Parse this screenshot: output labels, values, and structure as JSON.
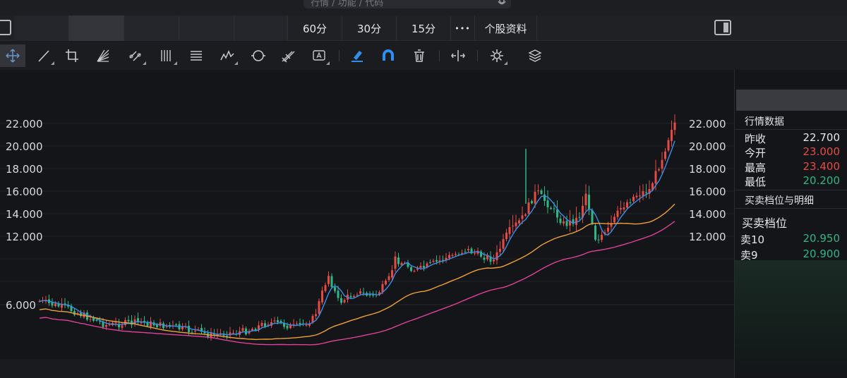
{
  "search": {
    "placeholder": "行情 / 功能 / 代码"
  },
  "tabs": [
    "60分",
    "30分",
    "15分",
    "个股资料"
  ],
  "more_label": "•••",
  "toolbar": {
    "tools": [
      "move-cursor",
      "line",
      "crop",
      "fan",
      "parallel",
      "vertical-lines",
      "text-box",
      "wave",
      "cycle",
      "pitchfork",
      "annotation",
      "highlighter",
      "magnet",
      "delete",
      "fit-width",
      "settings",
      "layers"
    ]
  },
  "colors": {
    "up": "#e64a44",
    "down": "#2fb783",
    "ma_short": "#3a8ee8",
    "ma_mid": "#f0a038",
    "ma_long": "#e0409a",
    "accent_blue": "#2f8ff0"
  },
  "axis": {
    "left_ticks": [
      "22.000",
      "20.000",
      "18.000",
      "16.000",
      "14.000",
      "12.000",
      "6.000"
    ],
    "right_ticks": [
      "22.000",
      "20.000",
      "18.000",
      "16.000",
      "14.000",
      "12.000"
    ]
  },
  "side": {
    "quote_title": "行情数据",
    "quote": [
      {
        "label": "昨收",
        "value": "22.700",
        "color": "#e6e7ea"
      },
      {
        "label": "今开",
        "value": "23.000",
        "color": "#e64a44"
      },
      {
        "label": "最高",
        "value": "23.400",
        "color": "#e64a44"
      },
      {
        "label": "最低",
        "value": "20.200",
        "color": "#2fb783"
      }
    ],
    "order_title": "买卖档位与明细",
    "order_big_title": "买卖档位",
    "asks": [
      {
        "label": "卖10",
        "value": "20.950"
      },
      {
        "label": "卖9",
        "value": "20.900"
      }
    ]
  }
}
